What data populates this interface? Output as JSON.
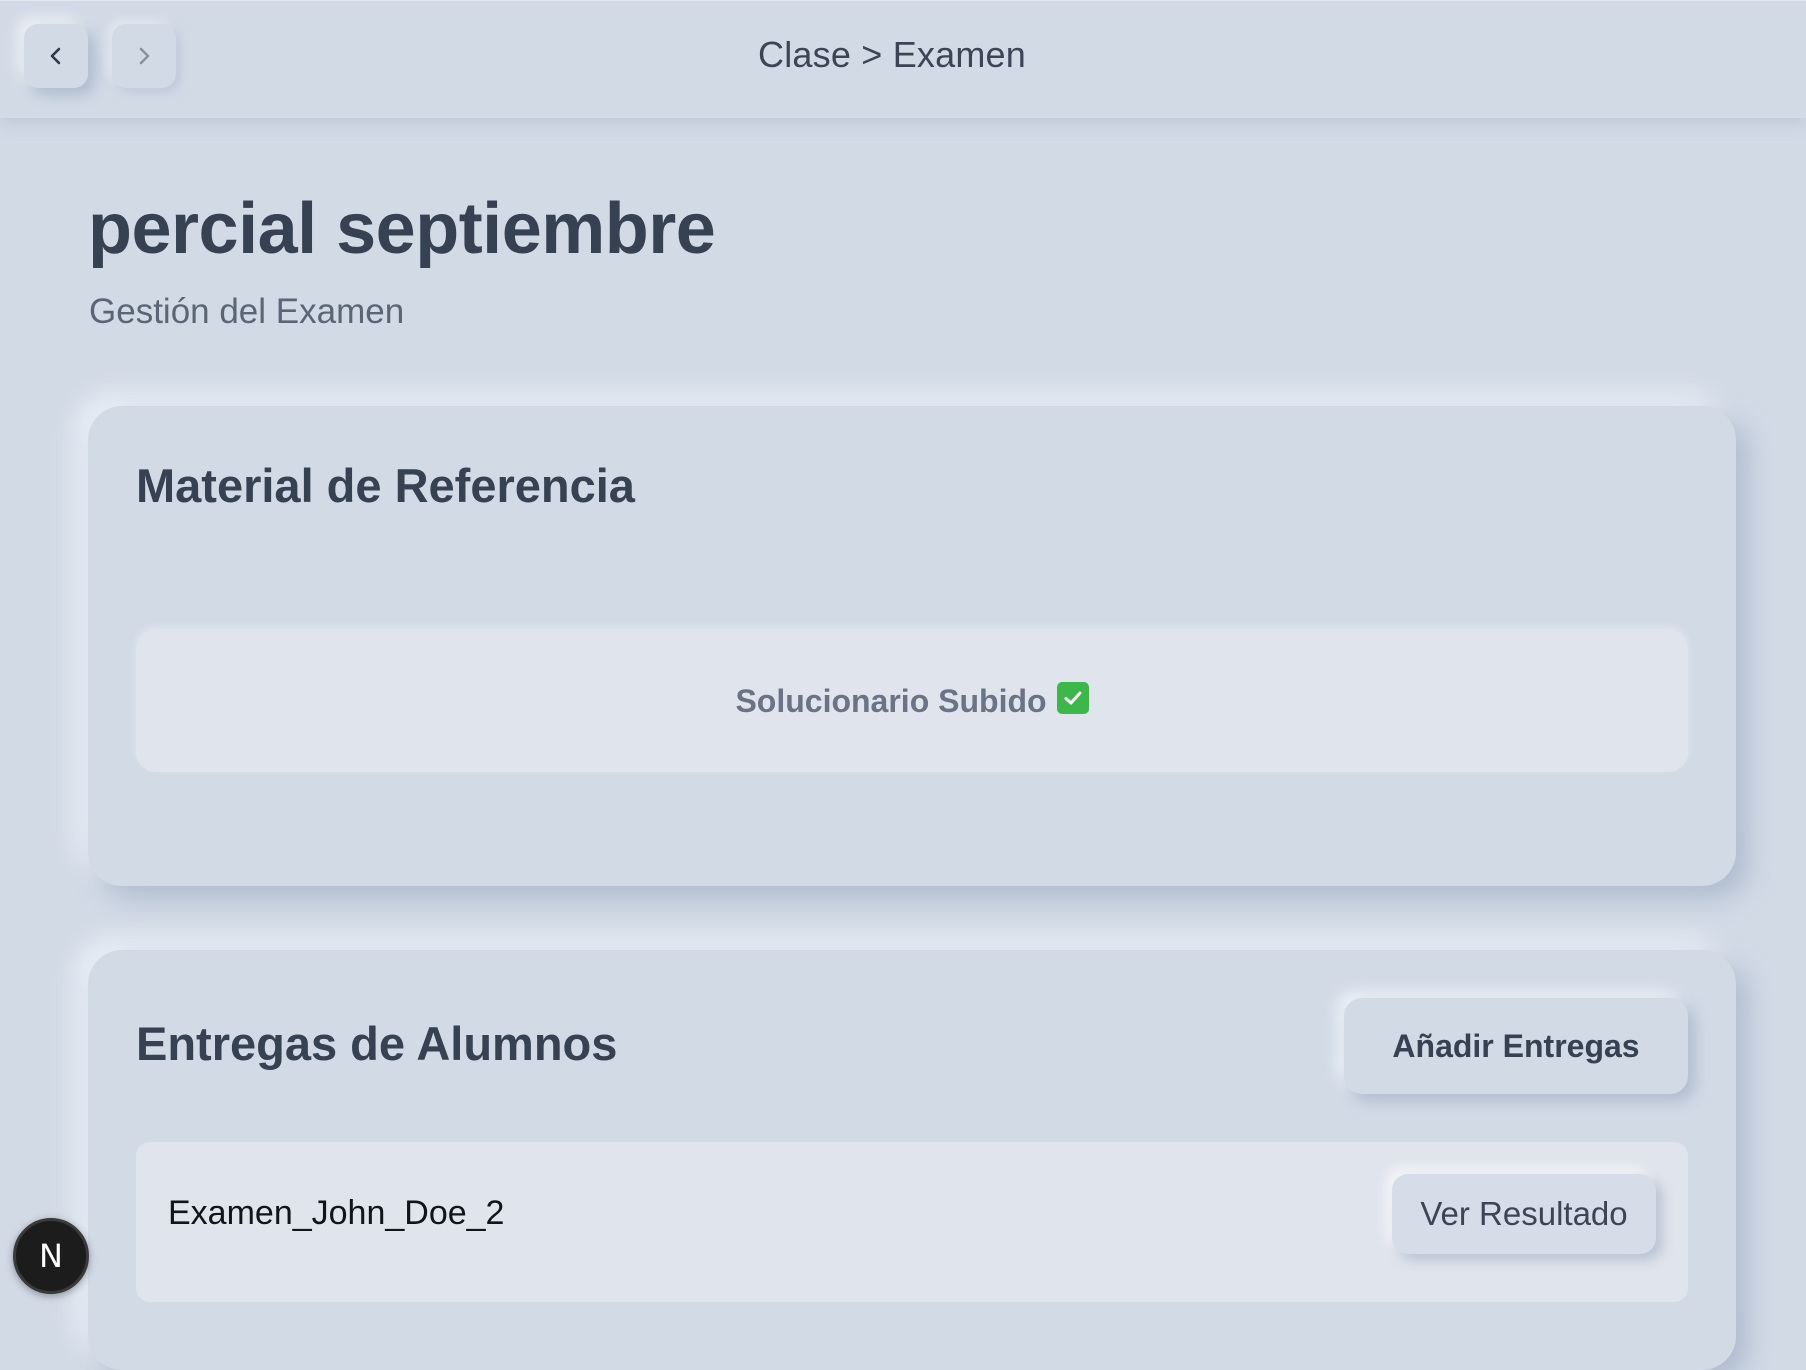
{
  "header": {
    "breadcrumb": "Clase > Examen",
    "back_icon": "chevron-left-icon",
    "forward_icon": "chevron-right-icon"
  },
  "page": {
    "title": "percial septiembre",
    "subtitle": "Gestión del Examen"
  },
  "reference": {
    "title": "Material de Referencia",
    "status_text": "Solucionario Subido",
    "status_icon": "check-mark-icon",
    "status_color": "#3cb84a"
  },
  "submissions": {
    "title": "Entregas de Alumnos",
    "add_button": "Añadir Entregas",
    "items": [
      {
        "name": "Examen_John_Doe_2",
        "action": "Ver Resultado"
      }
    ]
  },
  "dev_badge": {
    "letter": "N"
  },
  "colors": {
    "background": "#d2dae6",
    "text_primary": "#364152",
    "panel": "#e0e4ec",
    "success": "#3cb84a"
  }
}
